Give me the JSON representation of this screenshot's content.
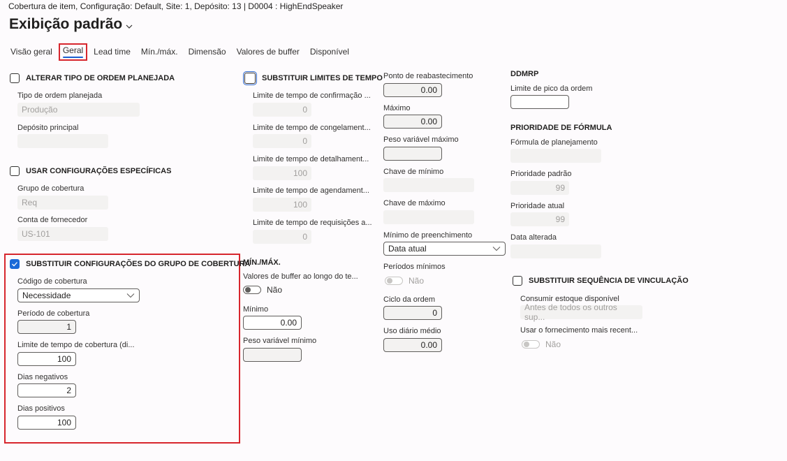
{
  "header": {
    "caption": "Cobertura de item, Configuração: Default, Site: 1, Depósito: 13  |  D0004 : HighEndSpeaker",
    "title": "Exibição padrão"
  },
  "tabs": [
    {
      "label": "Visão geral",
      "active": false
    },
    {
      "label": "Geral",
      "active": true
    },
    {
      "label": "Lead time",
      "active": false
    },
    {
      "label": "Mín./máx.",
      "active": false
    },
    {
      "label": "Dimensão",
      "active": false
    },
    {
      "label": "Valores de buffer",
      "active": false
    },
    {
      "label": "Disponível",
      "active": false
    }
  ],
  "col1": {
    "alterar_tipo": {
      "title": "ALTERAR TIPO DE ORDEM PLANEJADA",
      "checked": false,
      "tipo_label": "Tipo de ordem planejada",
      "tipo_value": "Produção",
      "deposito_label": "Depósito principal",
      "deposito_value": ""
    },
    "usar_config": {
      "title": "USAR CONFIGURAÇÕES ESPECÍFICAS",
      "checked": false,
      "grupo_label": "Grupo de cobertura",
      "grupo_value": "Req",
      "conta_label": "Conta de fornecedor",
      "conta_value": "US-101"
    },
    "substituir_grupo": {
      "title": "SUBSTITUIR CONFIGURAÇÕES DO GRUPO DE COBERTURA",
      "checked": true,
      "codigo_label": "Código de cobertura",
      "codigo_value": "Necessidade",
      "periodo_label": "Período de cobertura",
      "periodo_value": "1",
      "limite_label": "Limite de tempo de cobertura (di...",
      "limite_value": "100",
      "neg_label": "Dias negativos",
      "neg_value": "2",
      "pos_label": "Dias positivos",
      "pos_value": "100"
    }
  },
  "col2": {
    "limites": {
      "title": "SUBSTITUIR LIMITES DE TEMPO",
      "checked": false,
      "items": [
        {
          "label": "Limite de tempo de confirmação ...",
          "value": "0"
        },
        {
          "label": "Limite de tempo de congelament...",
          "value": "0"
        },
        {
          "label": "Limite de tempo de detalhament...",
          "value": "100"
        },
        {
          "label": "Limite de tempo de agendament...",
          "value": "100"
        },
        {
          "label": "Limite de tempo de requisições a...",
          "value": "0"
        }
      ]
    },
    "minmax": {
      "title": "MÍN./MÁX.",
      "buffer_label": "Valores de buffer ao longo do te...",
      "buffer_value": "Não",
      "minimo_label": "Mínimo",
      "minimo_value": "0.00",
      "peso_min_label": "Peso variável mínimo",
      "peso_min_value": ""
    }
  },
  "col3": {
    "ponto_label": "Ponto de reabastecimento",
    "ponto_value": "0.00",
    "maximo_label": "Máximo",
    "maximo_value": "0.00",
    "peso_max_label": "Peso variável máximo",
    "peso_max_value": "",
    "chave_min_label": "Chave de mínimo",
    "chave_min_value": "",
    "chave_max_label": "Chave de máximo",
    "chave_max_value": "",
    "min_preench_label": "Mínimo de preenchimento",
    "min_preench_value": "Data atual",
    "periodos_label": "Períodos mínimos",
    "periodos_value": "Não",
    "ciclo_label": "Ciclo da ordem",
    "ciclo_value": "0",
    "uso_label": "Uso diário médio",
    "uso_value": "0.00"
  },
  "col4": {
    "ddmrp_title": "DDMRP",
    "pico_label": "Limite de pico da ordem",
    "pico_value": "",
    "prioridade_title": "PRIORIDADE DE FÓRMULA",
    "formula_label": "Fórmula de planejamento",
    "formula_value": "",
    "prio_padrao_label": "Prioridade padrão",
    "prio_padrao_value": "99",
    "prio_atual_label": "Prioridade atual",
    "prio_atual_value": "99",
    "data_alt_label": "Data alterada",
    "data_alt_value": "",
    "sequencia": {
      "title": "SUBSTITUIR SEQUÊNCIA DE VINCULAÇÃO",
      "checked": false,
      "consumir_label": "Consumir estoque disponível",
      "consumir_value": "Antes de todos os outros sup...",
      "usar_label": "Usar o fornecimento mais recent...",
      "usar_value": "Não"
    }
  },
  "colors": {
    "accent": "#1a6ad8",
    "highlight_box": "#d7262d",
    "tab_underline": "#1a5fd0"
  }
}
